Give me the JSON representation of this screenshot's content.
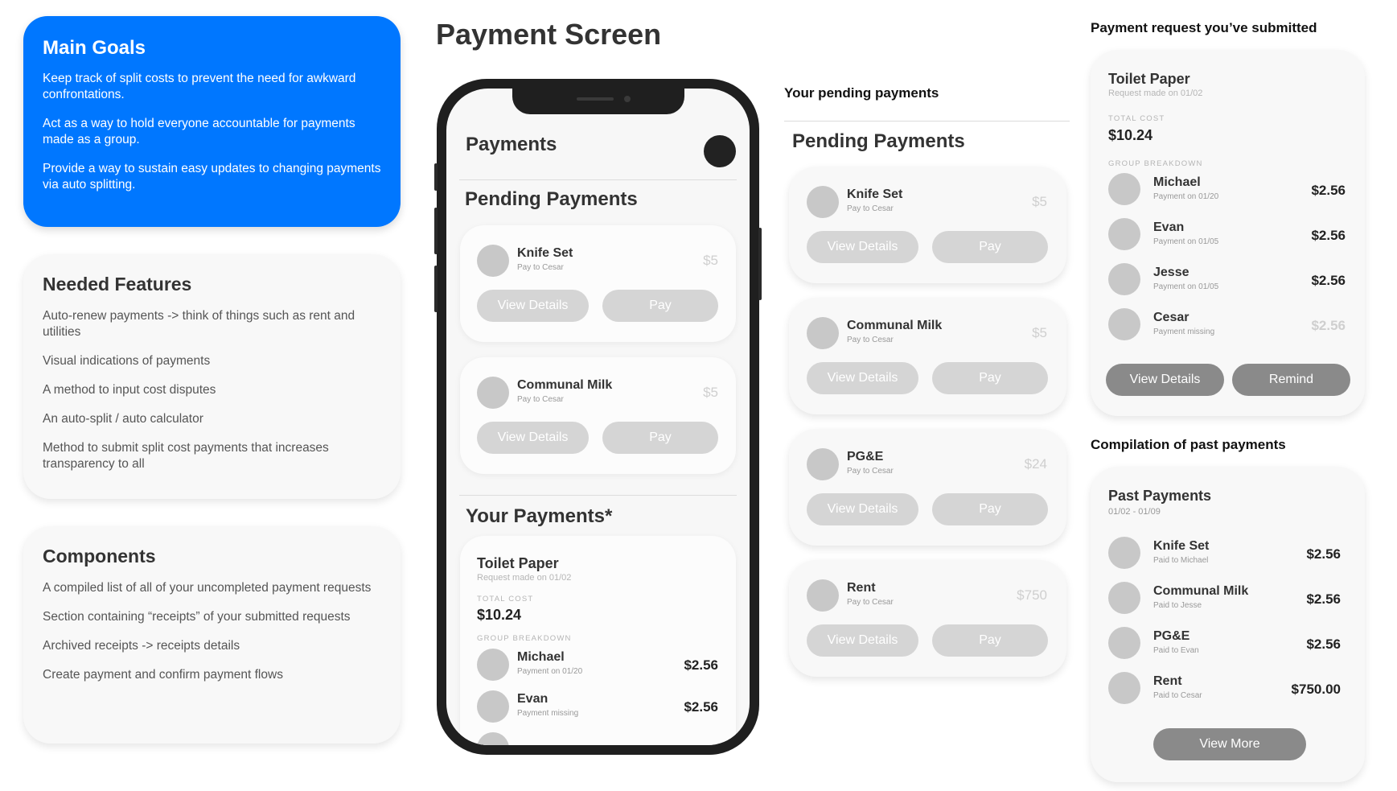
{
  "page_title": "Payment Screen",
  "main_goals": {
    "title": "Main Goals",
    "items": [
      "Keep track of split costs to prevent the need for awkward confrontations.",
      "Act as a way to hold everyone accountable for payments made as a group.",
      "Provide a way to sustain easy updates to changing payments via auto splitting."
    ]
  },
  "needed_features": {
    "title": "Needed Features",
    "items": [
      "Auto-renew payments -> think of things such as rent and utilities",
      "Visual indications of payments",
      "A method to input cost disputes",
      "An auto-split / auto calculator",
      "Method to submit split cost payments that increases transparency to all"
    ]
  },
  "components": {
    "title": "Components",
    "items": [
      "A compiled list of all of your uncompleted payment requests",
      "Section containing “receipts” of your submitted requests",
      "Archived receipts -> receipts details",
      "Create payment and confirm payment flows"
    ]
  },
  "phone": {
    "header": "Payments",
    "pending_title": "Pending Payments",
    "pending": [
      {
        "name": "Knife Set",
        "sub": "Pay to Cesar",
        "amount": "$5"
      },
      {
        "name": "Communal Milk",
        "sub": "Pay to Cesar",
        "amount": "$5"
      }
    ],
    "your_payments_title": "Your Payments*",
    "receipt": {
      "title": "Toilet Paper",
      "sub": "Request made on 01/02",
      "total_caption": "TOTAL COST",
      "total": "$10.24",
      "breakdown_caption": "GROUP BREAKDOWN",
      "rows": [
        {
          "name": "Michael",
          "sub": "Payment on 01/20",
          "amount": "$2.56"
        },
        {
          "name": "Evan",
          "sub": "Payment missing",
          "amount": "$2.56"
        }
      ]
    }
  },
  "buttons": {
    "view_details": "View Details",
    "pay": "Pay",
    "remind": "Remind",
    "view_more": "View More"
  },
  "pending_column": {
    "label": "Your pending payments",
    "title": "Pending Payments",
    "items": [
      {
        "name": "Knife Set",
        "sub": "Pay to Cesar",
        "amount": "$5"
      },
      {
        "name": "Communal Milk",
        "sub": "Pay to Cesar",
        "amount": "$5"
      },
      {
        "name": "PG&E",
        "sub": "Pay to Cesar",
        "amount": "$24"
      },
      {
        "name": "Rent",
        "sub": "Pay to Cesar",
        "amount": "$750"
      }
    ]
  },
  "submitted": {
    "label": "Payment request you’ve submitted",
    "title": "Toilet Paper",
    "sub": "Request made on 01/02",
    "total_caption": "TOTAL COST",
    "total": "$10.24",
    "breakdown_caption": "GROUP BREAKDOWN",
    "rows": [
      {
        "name": "Michael",
        "sub": "Payment on 01/20",
        "amount": "$2.56"
      },
      {
        "name": "Evan",
        "sub": "Payment on 01/05",
        "amount": "$2.56"
      },
      {
        "name": "Jesse",
        "sub": "Payment on 01/05",
        "amount": "$2.56"
      },
      {
        "name": "Cesar",
        "sub": "Payment missing",
        "amount": "$2.56"
      }
    ]
  },
  "past": {
    "label": "Compilation of past payments",
    "title": "Past Payments",
    "range": "01/02 - 01/09",
    "rows": [
      {
        "name": "Knife Set",
        "sub": "Paid to Michael",
        "amount": "$2.56"
      },
      {
        "name": "Communal Milk",
        "sub": "Paid to Jesse",
        "amount": "$2.56"
      },
      {
        "name": "PG&E",
        "sub": "Paid to Evan",
        "amount": "$2.56"
      },
      {
        "name": "Rent",
        "sub": "Paid to Cesar",
        "amount": "$750.00"
      }
    ]
  },
  "colors": {
    "accent_blue": "#0077ff",
    "button_light": "#d5d5d5",
    "button_dark": "#8a8a8a",
    "avatar": "#c8c8c8"
  }
}
